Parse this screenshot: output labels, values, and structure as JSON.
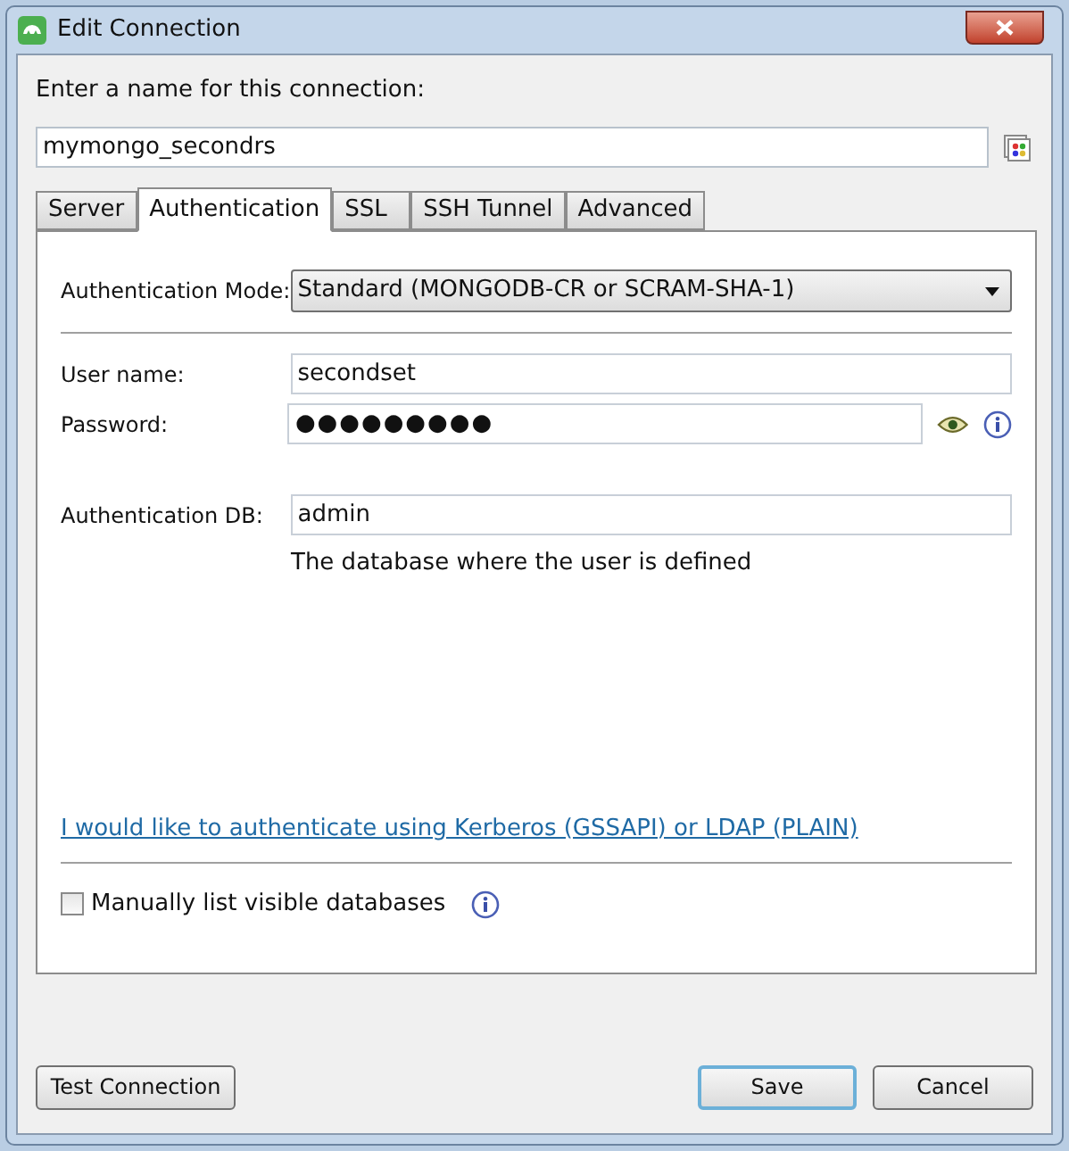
{
  "window": {
    "title": "Edit Connection"
  },
  "name_prompt": "Enter a name for this connection:",
  "name_field": {
    "value": "mymongo_secondrs"
  },
  "tabs": [
    {
      "label": "Server",
      "selected": false
    },
    {
      "label": "Authentication",
      "selected": true
    },
    {
      "label": "SSL",
      "selected": false
    },
    {
      "label": "SSH Tunnel",
      "selected": false
    },
    {
      "label": "Advanced",
      "selected": false
    }
  ],
  "auth_mode": {
    "label": "Authentication Mode:",
    "value": "Standard (MONGODB-CR or SCRAM-SHA-1)"
  },
  "user_name": {
    "label": "User name:",
    "value": "secondset"
  },
  "password": {
    "label": "Password:",
    "value": "●●●●●●●●●"
  },
  "auth_db": {
    "label": "Authentication DB:",
    "value": "admin",
    "hint": "The database where the user is defined"
  },
  "kerberos_link": "I would like to authenticate using Kerberos (GSSAPI) or LDAP (PLAIN)",
  "manual_list": {
    "label": "Manually list visible databases",
    "checked": false
  },
  "buttons": [
    {
      "label": "Test Connection",
      "default": false
    },
    {
      "label": "Save",
      "default": true
    },
    {
      "label": "Cancel",
      "default": false
    }
  ]
}
